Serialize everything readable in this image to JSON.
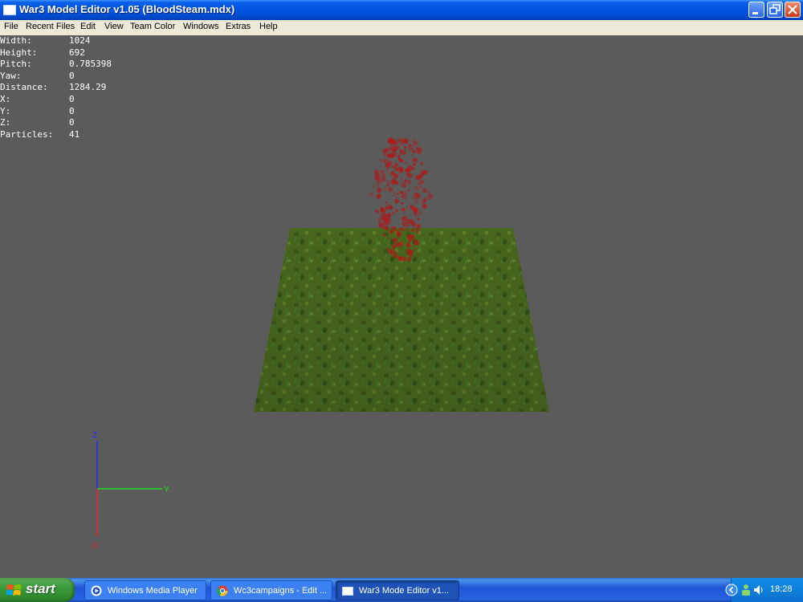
{
  "window": {
    "title": "War3 Model Editor v1.05 (BloodSteam.mdx)"
  },
  "menu": [
    "File",
    "Recent Files",
    "Edit",
    "View",
    "Team Color",
    "Windows",
    "Extras",
    "Help"
  ],
  "stats": [
    {
      "label": "Width:",
      "value": "1024"
    },
    {
      "label": "Height:",
      "value": "692"
    },
    {
      "label": "Pitch:",
      "value": "0.785398"
    },
    {
      "label": "Yaw:",
      "value": "0"
    },
    {
      "label": "Distance:",
      "value": "1284.29"
    },
    {
      "label": "X:",
      "value": "0"
    },
    {
      "label": "Y:",
      "value": "0"
    },
    {
      "label": "Z:",
      "value": "0"
    },
    {
      "label": "Particles:",
      "value": "41"
    }
  ],
  "axes": {
    "z_label": "Z",
    "y_label": "Y",
    "x_label": "X",
    "z_color": "#2030ff",
    "y_color": "#22dd22",
    "x_color": "#ee2222"
  },
  "scene": {
    "particle_color": "#b01818",
    "ground_color": "#4a6a1e"
  },
  "taskbar": {
    "start_label": "start",
    "tasks": [
      {
        "label": "Windows Media Player",
        "icon": "media-player-icon"
      },
      {
        "label": "Wc3campaigns - Edit ...",
        "icon": "chrome-icon"
      },
      {
        "label": "War3 Mode Editor v1...",
        "icon": "window-icon"
      }
    ],
    "clock": "18:28"
  }
}
